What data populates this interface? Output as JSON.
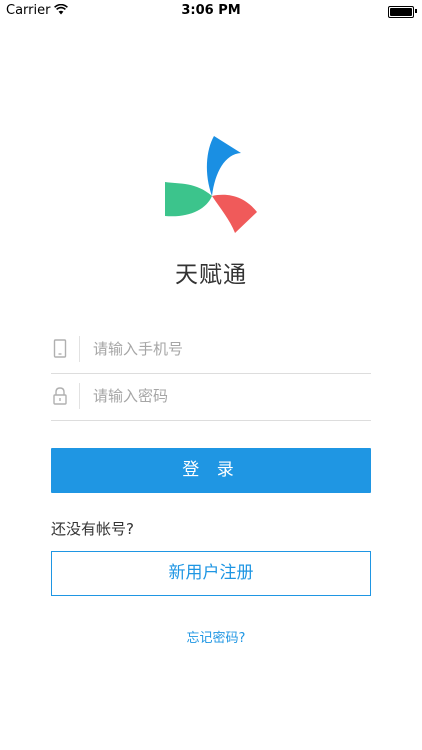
{
  "status_bar": {
    "carrier": "Carrier",
    "time": "3:06 PM",
    "icons": [
      "wifi-icon",
      "battery-icon"
    ]
  },
  "app": {
    "name": "天赋通",
    "logo_colors": {
      "blue": "#1a8fe3",
      "green": "#3cc48c",
      "red": "#f05a5a"
    }
  },
  "form": {
    "phone": {
      "placeholder": "请输入手机号",
      "value": "",
      "icon": "phone-icon"
    },
    "password": {
      "placeholder": "请输入密码",
      "value": "",
      "icon": "lock-icon"
    }
  },
  "buttons": {
    "login": "登 录",
    "register": "新用户注册"
  },
  "text": {
    "no_account": "还没有帐号?",
    "forgot_password": "忘记密码?"
  },
  "colors": {
    "accent": "#1f96e3"
  }
}
